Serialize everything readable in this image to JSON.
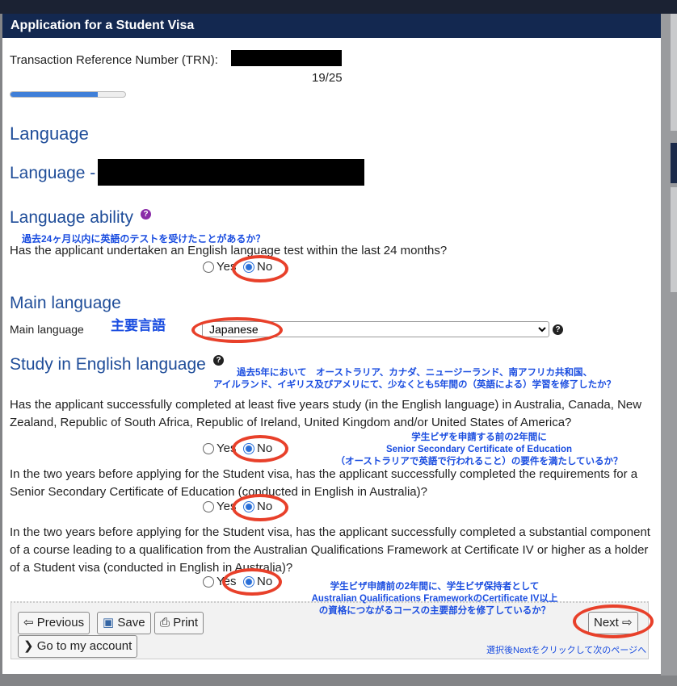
{
  "window": {
    "title": "Application for a Student Visa"
  },
  "trn": {
    "label": "Transaction Reference Number (TRN):"
  },
  "progress": {
    "text": "19/25",
    "fraction": 0.76
  },
  "sections": {
    "language": "Language",
    "language_sub": "Language -",
    "language_ability": "Language ability",
    "main_language": "Main language",
    "study_english": "Study in English language"
  },
  "questions": {
    "q1": "Has the applicant undertaken an English language test within the last 24 months?",
    "main_language_label": "Main language",
    "q2": "Has the applicant successfully completed at least five years study (in the English language) in Australia, Canada, New Zealand, Republic of South Africa, Republic of Ireland, United Kingdom and/or United States of America?",
    "q3": "In the two years before applying for the Student visa, has the applicant successfully completed the requirements for a Senior Secondary Certificate of Education (conducted in English in Australia)?",
    "q4": "In the two years before applying for the Student visa, has the applicant successfully completed a substantial component of a course leading to a qualification from the Australian Qualifications Framework at Certificate IV or higher as a holder of a Student visa (conducted in English in Australia)?"
  },
  "options": {
    "yes": "Yes",
    "no": "No",
    "selected": "No"
  },
  "main_language": {
    "value": "Japanese"
  },
  "annotations": {
    "a1": "過去24ヶ月以内に英語のテストを受けたことがあるか？",
    "a_main": "主要言語",
    "a2_l1": "過去5年において　オーストラリア、カナダ、ニュージーランド、南アフリカ共和国、",
    "a2_l2": "アイルランド、イギリス及びアメリにて、少なくとも5年間の（英語による）学習を修了したか？",
    "a3_l1": "学生ビザを申請する前の2年間に",
    "a3_l2": "Senior Secondary Certificate of Education",
    "a3_l3": "（オーストラリアで英語で行われること）の要件を満たしているか？",
    "a4_l1": "学生ビザ申請前の2年間に、学生ビザ保持者として",
    "a4_l2": "Australian Qualifications FrameworkのCertificate IV以上",
    "a4_l3": "の資格につながるコースの主要部分を修了しているか？",
    "a_next": "選択後Nextをクリックして次のページへ"
  },
  "buttons": {
    "previous": "Previous",
    "save": "Save",
    "print": "Print",
    "next": "Next",
    "account": "Go to my account"
  },
  "colors": {
    "header": "#132850",
    "heading": "#1f4d99",
    "annotation": "#1a4de0",
    "highlight": "#e8402a",
    "help_ability": "#8a2aa8"
  }
}
